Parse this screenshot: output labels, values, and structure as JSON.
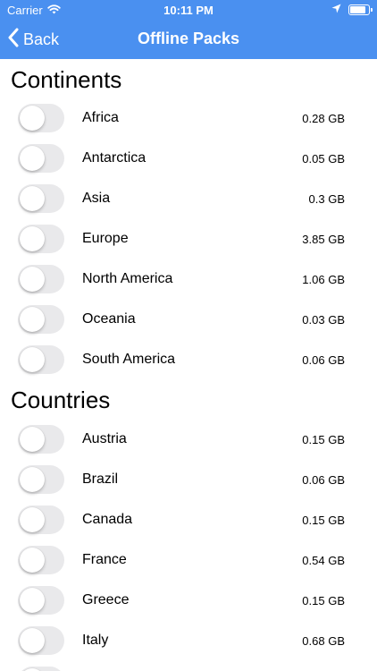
{
  "status_bar": {
    "carrier": "Carrier",
    "time": "10:11 PM",
    "icons": [
      "wifi-icon",
      "location-arrow-icon",
      "battery-icon"
    ]
  },
  "nav": {
    "back_label": "Back",
    "title": "Offline Packs",
    "bar_color": "#4a90f0"
  },
  "sections": {
    "continents": {
      "title": "Continents",
      "items": [
        {
          "name": "Africa",
          "size": "0.28 GB",
          "enabled": false
        },
        {
          "name": "Antarctica",
          "size": "0.05 GB",
          "enabled": false
        },
        {
          "name": "Asia",
          "size": "0.3 GB",
          "enabled": false
        },
        {
          "name": "Europe",
          "size": "3.85 GB",
          "enabled": false
        },
        {
          "name": "North America",
          "size": "1.06 GB",
          "enabled": false
        },
        {
          "name": "Oceania",
          "size": "0.03 GB",
          "enabled": false
        },
        {
          "name": "South America",
          "size": "0.06 GB",
          "enabled": false
        }
      ]
    },
    "countries": {
      "title": "Countries",
      "items": [
        {
          "name": "Austria",
          "size": "0.15 GB",
          "enabled": false
        },
        {
          "name": "Brazil",
          "size": "0.06 GB",
          "enabled": false
        },
        {
          "name": "Canada",
          "size": "0.15 GB",
          "enabled": false
        },
        {
          "name": "France",
          "size": "0.54 GB",
          "enabled": false
        },
        {
          "name": "Greece",
          "size": "0.15 GB",
          "enabled": false
        },
        {
          "name": "Italy",
          "size": "0.68 GB",
          "enabled": false
        }
      ]
    }
  }
}
